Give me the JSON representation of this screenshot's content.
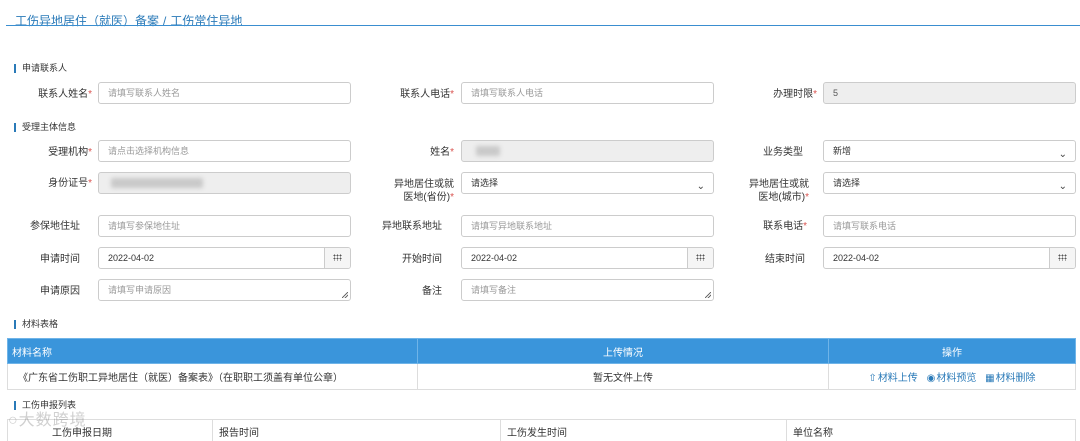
{
  "breadcrumb": {
    "parent": "工伤异地居住（就医）备案",
    "separator": "/",
    "current": "工伤常住异地"
  },
  "sections": {
    "applicant": "申请联系人",
    "subject": "受理主体信息",
    "materials": "材料表格",
    "reports": "工伤申报列表"
  },
  "applicant": {
    "contact_name_label": "联系人姓名",
    "contact_name_placeholder": "请填写联系人姓名",
    "contact_phone_label": "联系人电话",
    "contact_phone_placeholder": "请填写联系人电话",
    "duration_label": "办理时限",
    "duration_value": "5"
  },
  "subject": {
    "agency_label": "受理机构",
    "agency_placeholder": "请点击选择机构信息",
    "name_label": "姓名",
    "business_type_label": "业务类型",
    "business_type_value": "新增",
    "id_label": "身份证号",
    "province_label_1": "异地居住或就",
    "province_label_2": "医地(省份)",
    "province_value": "请选择",
    "city_label_1": "异地居住或就",
    "city_label_2": "医地(城市)",
    "city_value": "请选择",
    "insured_addr_label": "参保地住址",
    "insured_addr_placeholder": "请填写参保地住址",
    "remote_addr_label": "异地联系地址",
    "remote_addr_placeholder": "请填写异地联系地址",
    "phone_label": "联系电话",
    "phone_placeholder": "请填写联系电话",
    "apply_date_label": "申请时间",
    "apply_date_value": "2022-04-02",
    "start_date_label": "开始时间",
    "start_date_value": "2022-04-02",
    "end_date_label": "结束时间",
    "end_date_value": "2022-04-02",
    "reason_label": "申请原因",
    "reason_placeholder": "请填写申请原因",
    "remark_label": "备注",
    "remark_placeholder": "请填写备注"
  },
  "required_mark": "*",
  "materials_table": {
    "headers": [
      "材料名称",
      "上传情况",
      "操作"
    ],
    "rows": [
      {
        "name": "《广东省工伤职工异地居住（就医）备案表》（在职职工须盖有单位公章）",
        "status": "暂无文件上传"
      }
    ],
    "actions": {
      "upload": "材料上传",
      "preview": "材料预览",
      "delete": "材料删除"
    }
  },
  "reports_table": {
    "headers": [
      "工伤申报日期",
      "报告时间",
      "工伤发生时间",
      "单位名称"
    ]
  },
  "watermark": "大数跨境",
  "colors": {
    "accent": "#2a7ab8",
    "table_header": "#3a95db",
    "required": "#d9534f"
  }
}
